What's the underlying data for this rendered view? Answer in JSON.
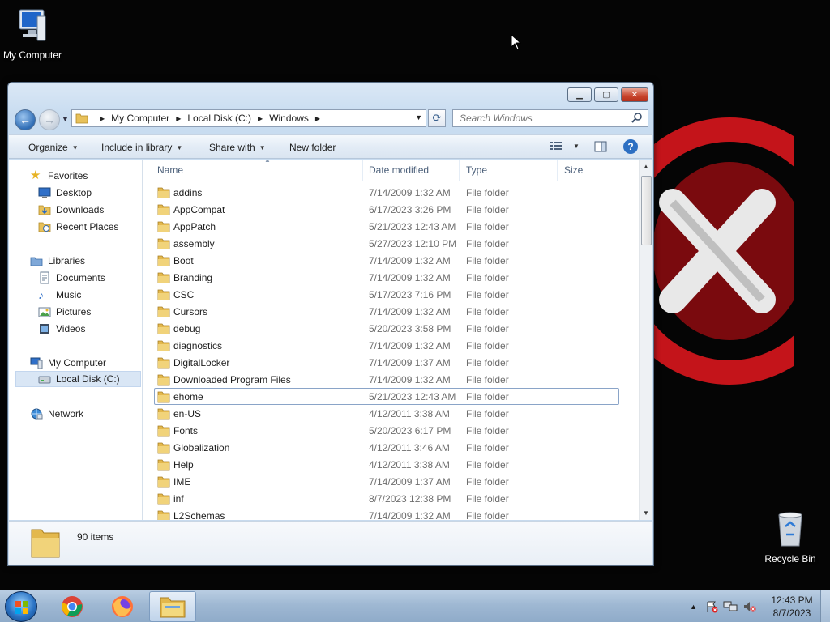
{
  "desktop": {
    "icons": [
      {
        "label": "My Computer"
      },
      {
        "label": "Recycle Bin"
      }
    ]
  },
  "explorer": {
    "breadcrumb": [
      "My Computer",
      "Local Disk (C:)",
      "Windows"
    ],
    "search_placeholder": "Search Windows",
    "toolbar": {
      "organize": "Organize",
      "include_in_library": "Include in library",
      "share_with": "Share with",
      "new_folder": "New folder"
    },
    "nav": {
      "favorites": "Favorites",
      "desktop": "Desktop",
      "downloads": "Downloads",
      "recent_places": "Recent Places",
      "libraries": "Libraries",
      "documents": "Documents",
      "music": "Music",
      "pictures": "Pictures",
      "videos": "Videos",
      "my_computer": "My Computer",
      "local_disk": "Local Disk (C:)",
      "network": "Network"
    },
    "columns": {
      "name": "Name",
      "date": "Date modified",
      "type": "Type",
      "size": "Size"
    },
    "files": [
      {
        "name": "addins",
        "date": "7/14/2009 1:32 AM",
        "type": "File folder"
      },
      {
        "name": "AppCompat",
        "date": "6/17/2023 3:26 PM",
        "type": "File folder"
      },
      {
        "name": "AppPatch",
        "date": "5/21/2023 12:43 AM",
        "type": "File folder"
      },
      {
        "name": "assembly",
        "date": "5/27/2023 12:10 PM",
        "type": "File folder"
      },
      {
        "name": "Boot",
        "date": "7/14/2009 1:32 AM",
        "type": "File folder"
      },
      {
        "name": "Branding",
        "date": "7/14/2009 1:32 AM",
        "type": "File folder"
      },
      {
        "name": "CSC",
        "date": "5/17/2023 7:16 PM",
        "type": "File folder"
      },
      {
        "name": "Cursors",
        "date": "7/14/2009 1:32 AM",
        "type": "File folder"
      },
      {
        "name": "debug",
        "date": "5/20/2023 3:58 PM",
        "type": "File folder"
      },
      {
        "name": "diagnostics",
        "date": "7/14/2009 1:32 AM",
        "type": "File folder"
      },
      {
        "name": "DigitalLocker",
        "date": "7/14/2009 1:37 AM",
        "type": "File folder"
      },
      {
        "name": "Downloaded Program Files",
        "date": "7/14/2009 1:32 AM",
        "type": "File folder"
      },
      {
        "name": "ehome",
        "date": "5/21/2023 12:43 AM",
        "type": "File folder"
      },
      {
        "name": "en-US",
        "date": "4/12/2011 3:38 AM",
        "type": "File folder"
      },
      {
        "name": "Fonts",
        "date": "5/20/2023 6:17 PM",
        "type": "File folder"
      },
      {
        "name": "Globalization",
        "date": "4/12/2011 3:46 AM",
        "type": "File folder"
      },
      {
        "name": "Help",
        "date": "4/12/2011 3:38 AM",
        "type": "File folder"
      },
      {
        "name": "IME",
        "date": "7/14/2009 1:37 AM",
        "type": "File folder"
      },
      {
        "name": "inf",
        "date": "8/7/2023 12:38 PM",
        "type": "File folder"
      },
      {
        "name": "L2Schemas",
        "date": "7/14/2009 1:32 AM",
        "type": "File folder"
      }
    ],
    "selected_file": "ehome",
    "item_count": "90 items"
  },
  "taskbar": {
    "apps": [
      "chrome-icon",
      "firefox-icon",
      "explorer-icon"
    ],
    "time": "12:43 PM",
    "date": "8/7/2023"
  },
  "colors": {
    "folder": "#e8c15a",
    "accent": "#2d6fc2",
    "close": "#c7432b"
  }
}
